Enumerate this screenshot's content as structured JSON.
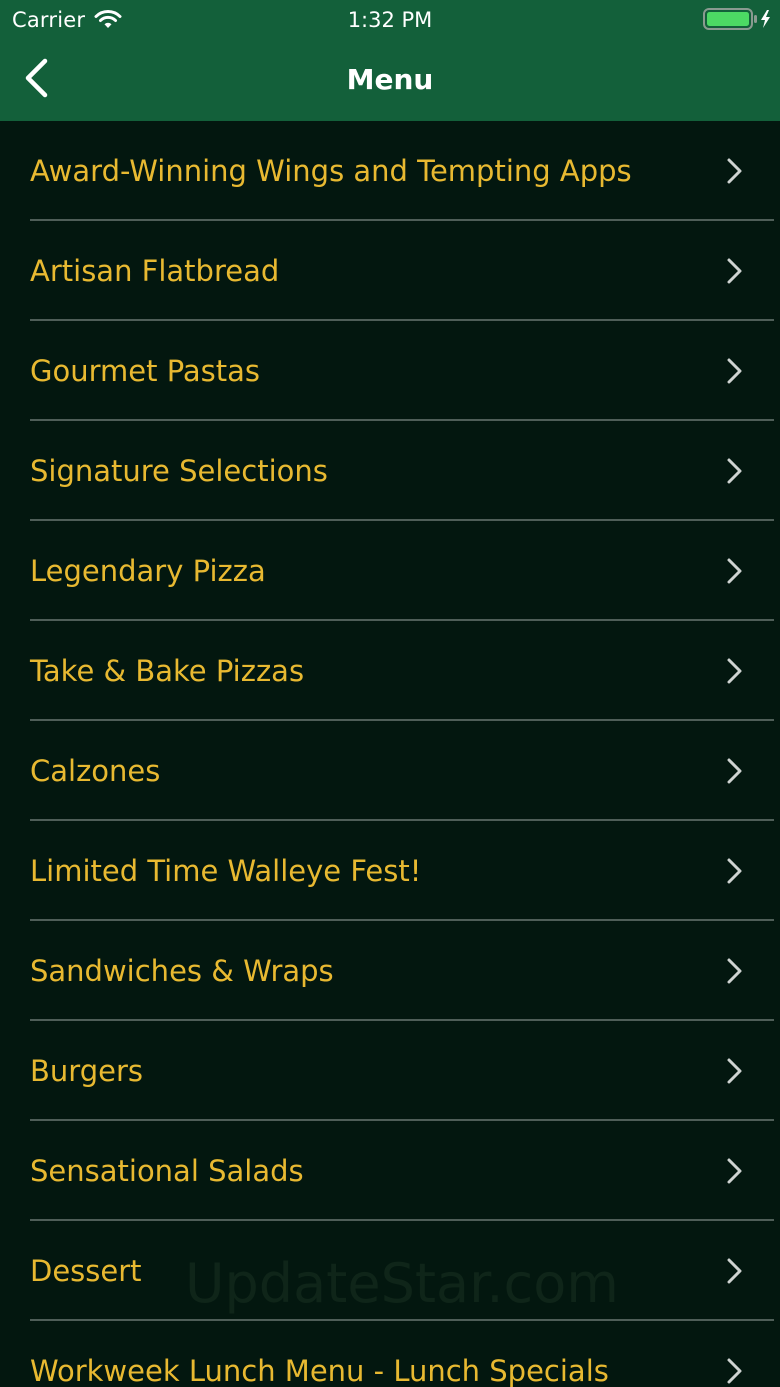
{
  "status_bar": {
    "carrier": "Carrier",
    "time": "1:32 PM",
    "wifi_icon": "wifi-icon",
    "battery_icon": "battery-charging-icon",
    "battery_color": "#4cd964"
  },
  "nav_bar": {
    "title": "Menu",
    "back_icon": "chevron-left-icon",
    "background_color": "#13603a"
  },
  "colors": {
    "background": "#03170f",
    "item_text": "#e8b931",
    "separator": "#4f5e58",
    "chevron": "#cfd3d1"
  },
  "menu": {
    "items": [
      {
        "label": "Award-Winning Wings and Tempting Apps"
      },
      {
        "label": "Artisan Flatbread"
      },
      {
        "label": "Gourmet Pastas"
      },
      {
        "label": "Signature Selections"
      },
      {
        "label": "Legendary Pizza"
      },
      {
        "label": "Take & Bake Pizzas"
      },
      {
        "label": "Calzones"
      },
      {
        "label": "Limited Time Walleye Fest!"
      },
      {
        "label": "Sandwiches & Wraps"
      },
      {
        "label": "Burgers"
      },
      {
        "label": "Sensational Salads"
      },
      {
        "label": "Dessert"
      },
      {
        "label": "Workweek Lunch Menu - Lunch Specials"
      }
    ],
    "row_icon": "chevron-right-icon"
  },
  "watermark": "UpdateStar.com"
}
